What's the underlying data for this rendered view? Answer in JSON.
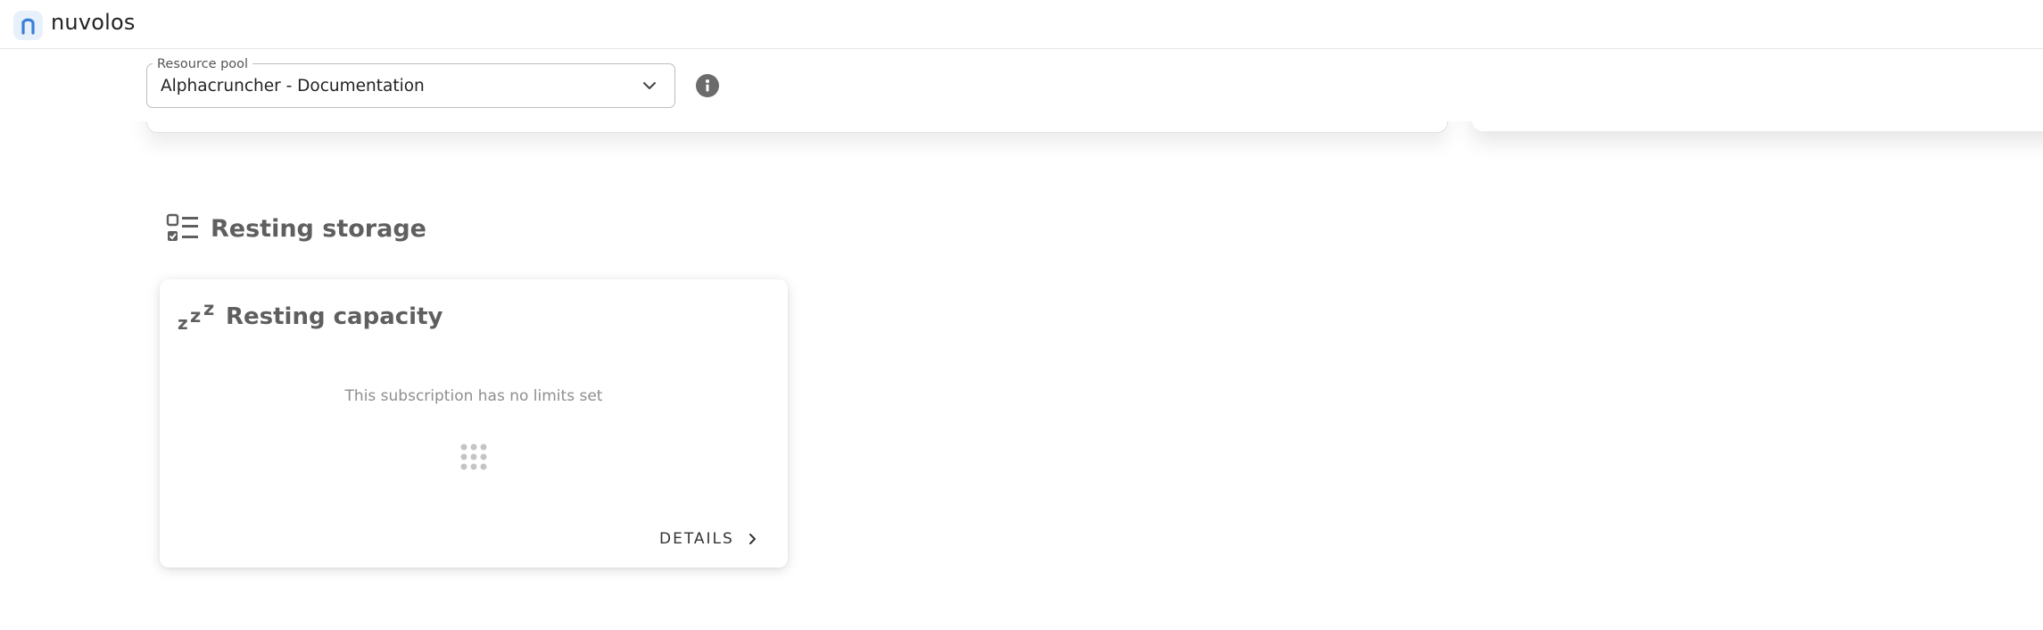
{
  "app": {
    "brand_name": "nuvolos",
    "logo_icon": "nuvolos-logo-icon",
    "brand_color": "#3b7fd6"
  },
  "resource_pool": {
    "label": "Resource pool",
    "selected_value": "Alphacruncher - Documentation",
    "dropdown_icon": "chevron-down-icon",
    "info_icon": "info-icon"
  },
  "section": {
    "title": "Resting storage",
    "icon": "checklist-icon"
  },
  "card": {
    "icon": "zzz-sleep-icon",
    "title": "Resting capacity",
    "message": "This subscription has no limits set",
    "loading_icon": "loading-dots-icon",
    "details_label": "DETAILS",
    "details_icon": "chevron-right-icon"
  }
}
